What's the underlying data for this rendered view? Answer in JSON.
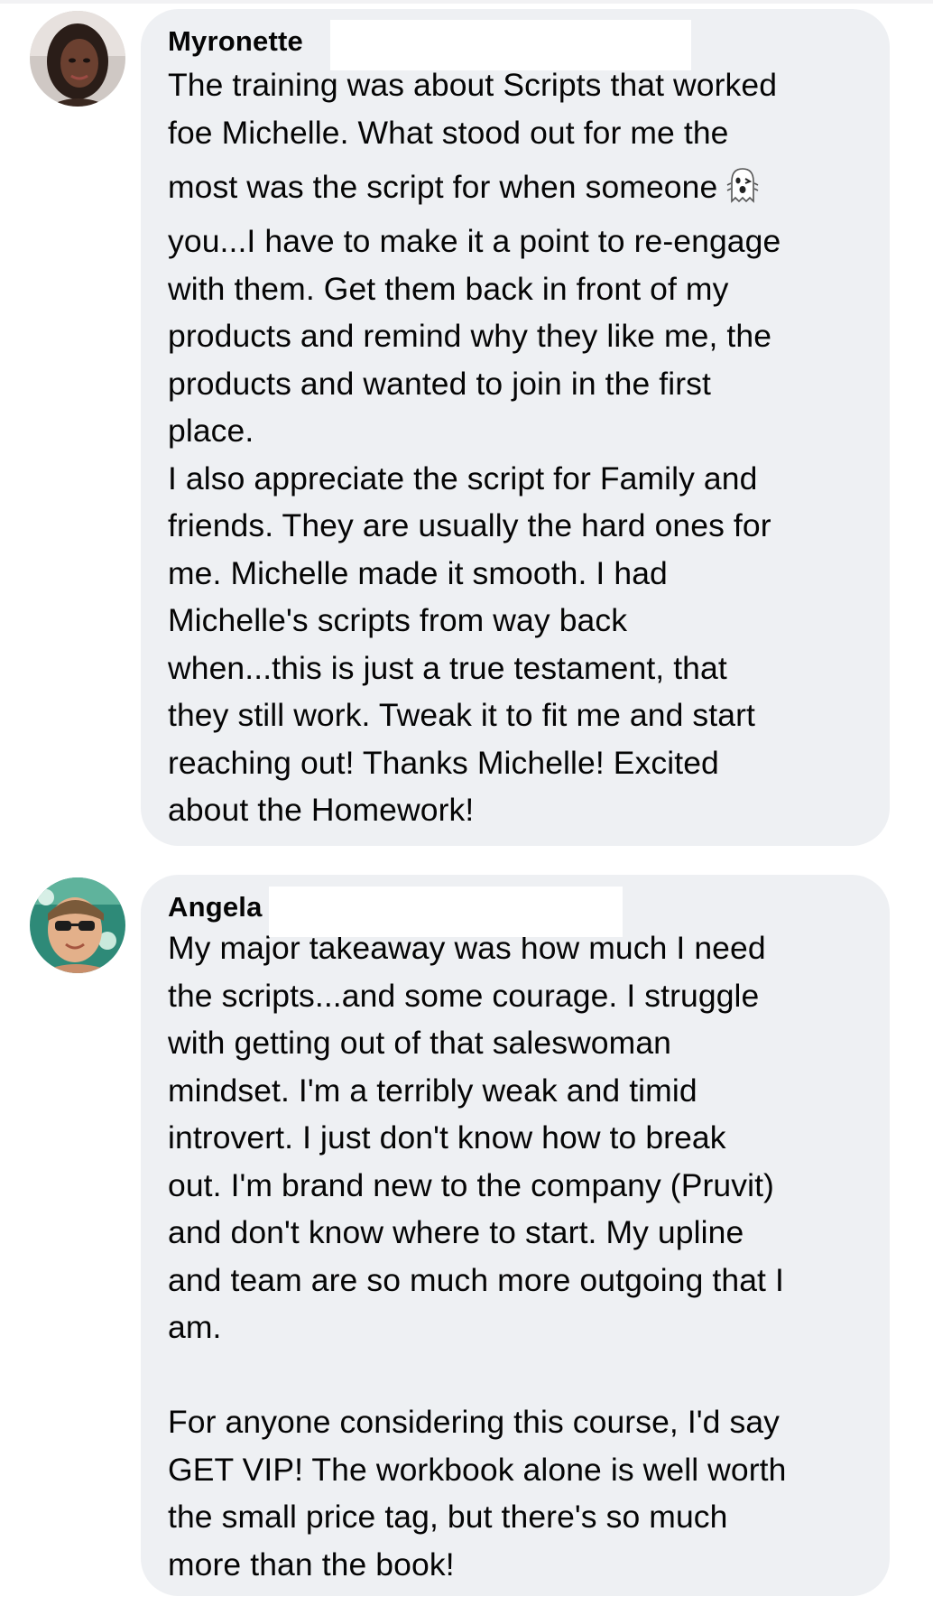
{
  "comments": [
    {
      "author": "Myronette",
      "lines": [
        "The training was about Scripts that worked",
        "foe Michelle. What stood out for me the",
        "most was the script for when someone",
        "you...I have to make it a point to re-engage",
        "with them. Get them back in front of my",
        "products and remind why they like me, the",
        "products and wanted to join in the first",
        "place.",
        "I also appreciate the script for Family and",
        "friends. They are usually the hard ones for",
        "me. Michelle made it smooth. I had",
        "Michelle's scripts from way back",
        "when...this is just a true testament, that",
        "they still work. Tweak it to fit me and start",
        "reaching out! Thanks Michelle! Excited",
        "about the Homework!"
      ],
      "inline_icon": "ghost-emoji-icon"
    },
    {
      "author": "Angela",
      "lines": [
        "My major takeaway was how much I need",
        "the scripts...and some courage. I struggle",
        "with getting out of that saleswoman",
        "mindset. I'm a terribly weak and timid",
        "introvert. I just don't know how to break",
        "out. I'm brand new to the company (Pruvit)",
        "and don't know where to start. My upline",
        "and team are so much more outgoing that I",
        "am.",
        "",
        "For anyone considering this course, I'd say",
        "GET VIP! The workbook alone is well worth",
        "the small price tag, but there's so much",
        "more than the book!"
      ]
    }
  ]
}
